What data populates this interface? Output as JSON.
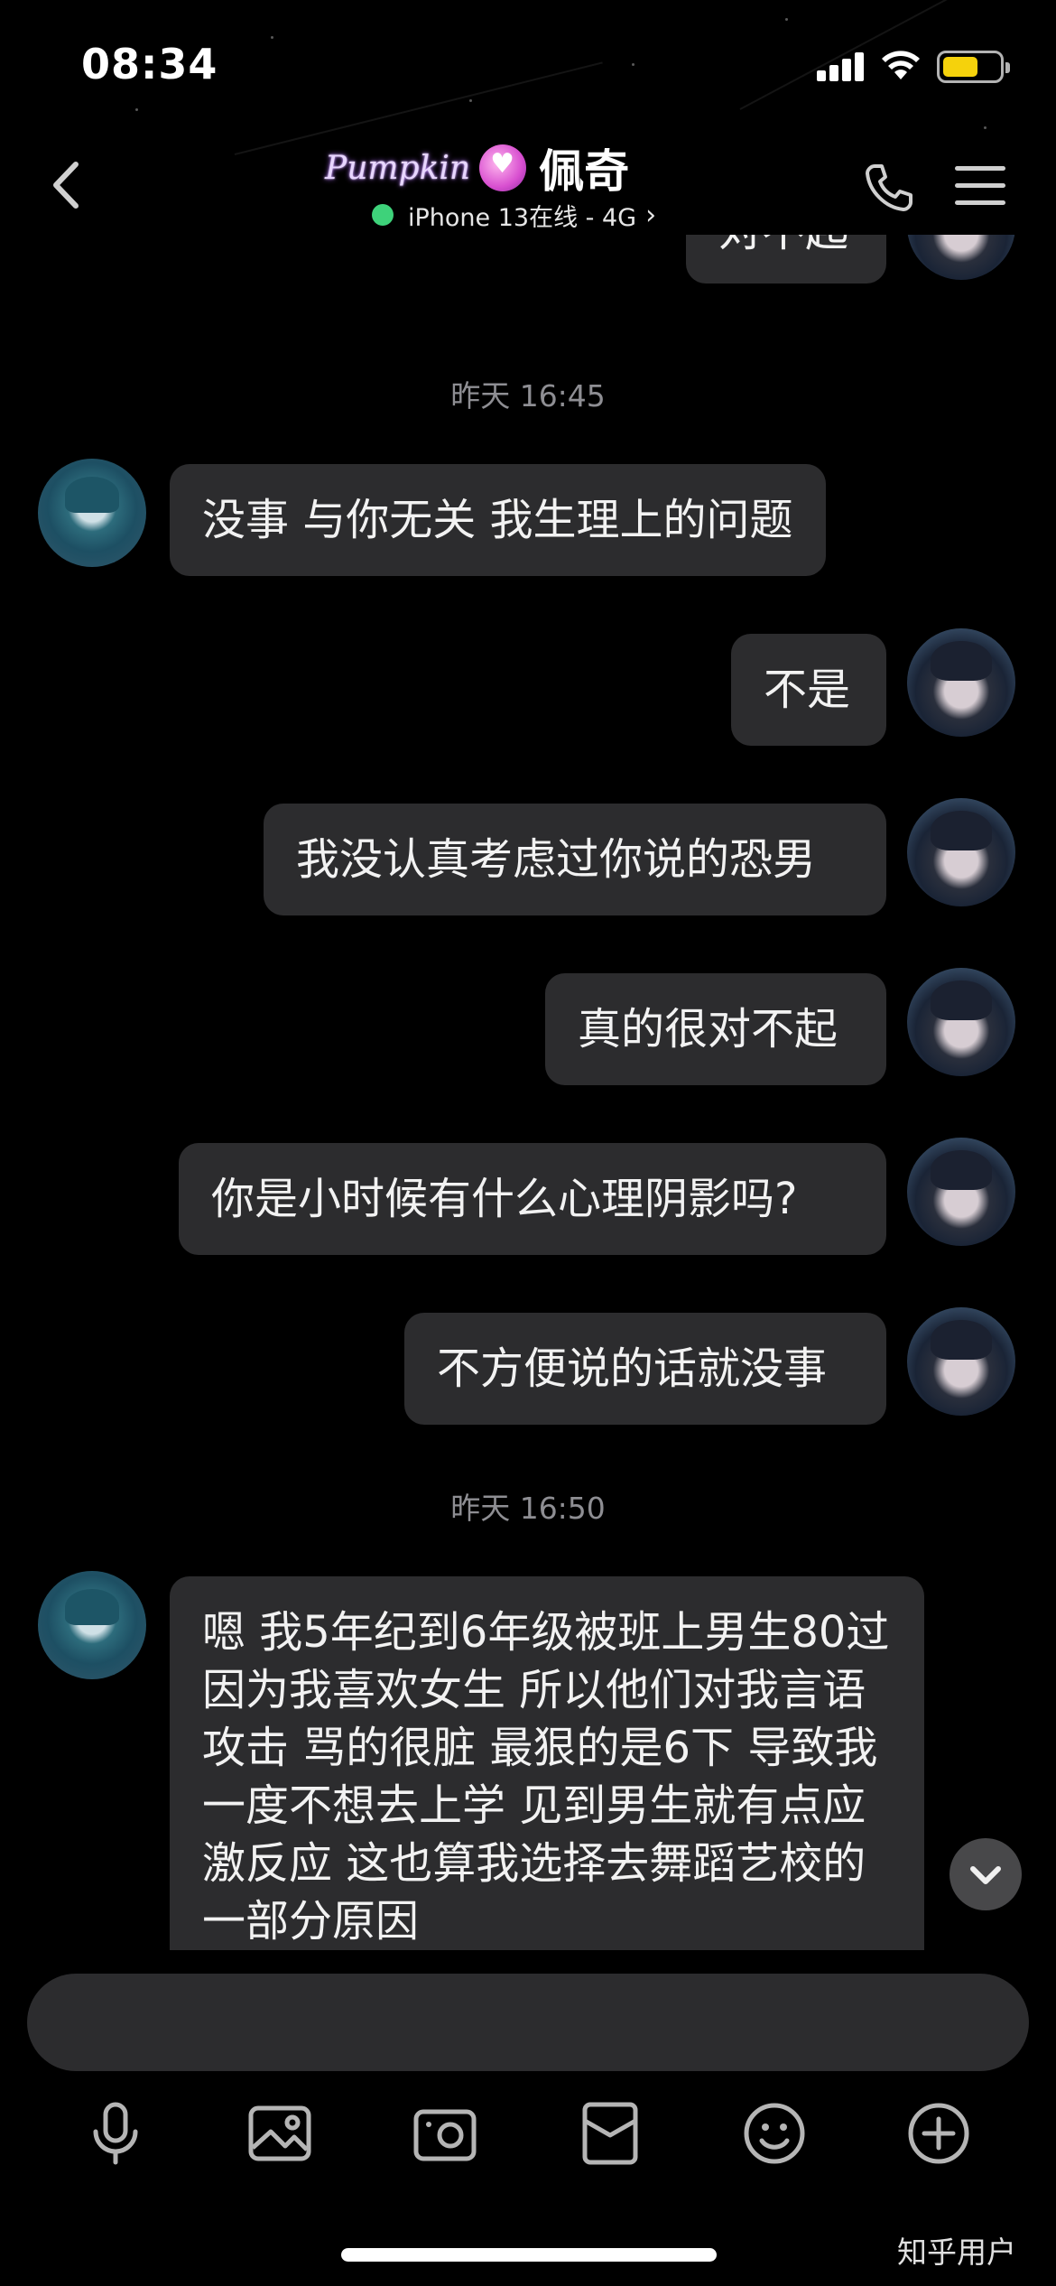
{
  "status_bar": {
    "time": "08:34"
  },
  "header": {
    "badge_text": "Pumpkin",
    "title": "佩奇",
    "subtitle": "iPhone 13在线 - 4G",
    "online_color": "#3ed27a"
  },
  "messages": [
    {
      "side": "right",
      "text": "对不起"
    },
    {
      "type": "timestamp",
      "text": "昨天 16:45"
    },
    {
      "side": "left",
      "text": "没事 与你无关 我生理上的问题"
    },
    {
      "side": "right",
      "text": "不是"
    },
    {
      "side": "right",
      "text": "我没认真考虑过你说的恐男"
    },
    {
      "side": "right",
      "text": "真的很对不起"
    },
    {
      "side": "right",
      "text": "你是小时候有什么心理阴影吗?"
    },
    {
      "side": "right",
      "text": "不方便说的话就没事"
    },
    {
      "type": "timestamp",
      "text": "昨天 16:50"
    },
    {
      "side": "left",
      "text": "嗯 我5年纪到6年级被班上男生80过 因为我喜欢女生 所以他们对我言语攻击 骂的很脏 最狠的是6下 导致我一度不想去上学 见到男生就有点应激反应 这也算我选择去舞蹈艺校的一部分原因"
    }
  ],
  "input": {
    "value": "",
    "placeholder": ""
  },
  "toolbar": {
    "icons": [
      "microphone-icon",
      "image-icon",
      "camera-icon",
      "red-packet-icon",
      "emoji-icon",
      "plus-icon"
    ]
  },
  "watermark": "知乎用户",
  "colors": {
    "background": "#000000",
    "bubble": "#2c2c2e",
    "battery": "#f5d20c",
    "timestamp": "#8e8e93"
  }
}
